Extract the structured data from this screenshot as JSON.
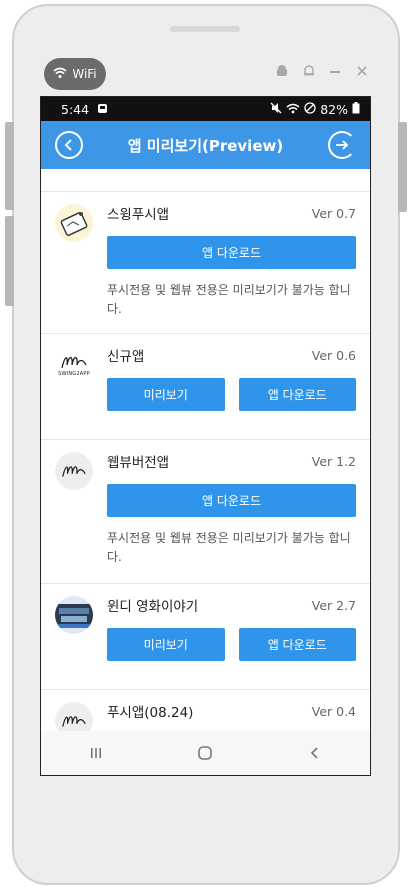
{
  "device": {
    "wifi_badge_label": "WiFi"
  },
  "status_bar": {
    "time": "5:44",
    "battery": "82%"
  },
  "header": {
    "title": "앱 미리보기(Preview)"
  },
  "apps": [
    {
      "name": "스윙푸시앱",
      "version": "Ver 0.7",
      "buttons": [
        "앱 다운로드"
      ],
      "notice": "푸시전용 및 웹뷰 전용은 미리보기가 불가능 합니다."
    },
    {
      "name": "신규앱",
      "version": "Ver 0.6",
      "buttons": [
        "미리보기",
        "앱 다운로드"
      ],
      "icon_text": "SWING2APP"
    },
    {
      "name": "웹뷰버전앱",
      "version": "Ver 1.2",
      "buttons": [
        "앱 다운로드"
      ],
      "notice": "푸시전용 및 웹뷰 전용은 미리보기가 불가능 합니다."
    },
    {
      "name": "윈디 영화이야기",
      "version": "Ver 2.7",
      "buttons": [
        "미리보기",
        "앱 다운로드"
      ]
    },
    {
      "name": "푸시앱(08.24)",
      "version": "Ver 0.4",
      "buttons": []
    }
  ],
  "colors": {
    "header_bg": "#3e97e6",
    "button_bg": "#2f95ea"
  }
}
